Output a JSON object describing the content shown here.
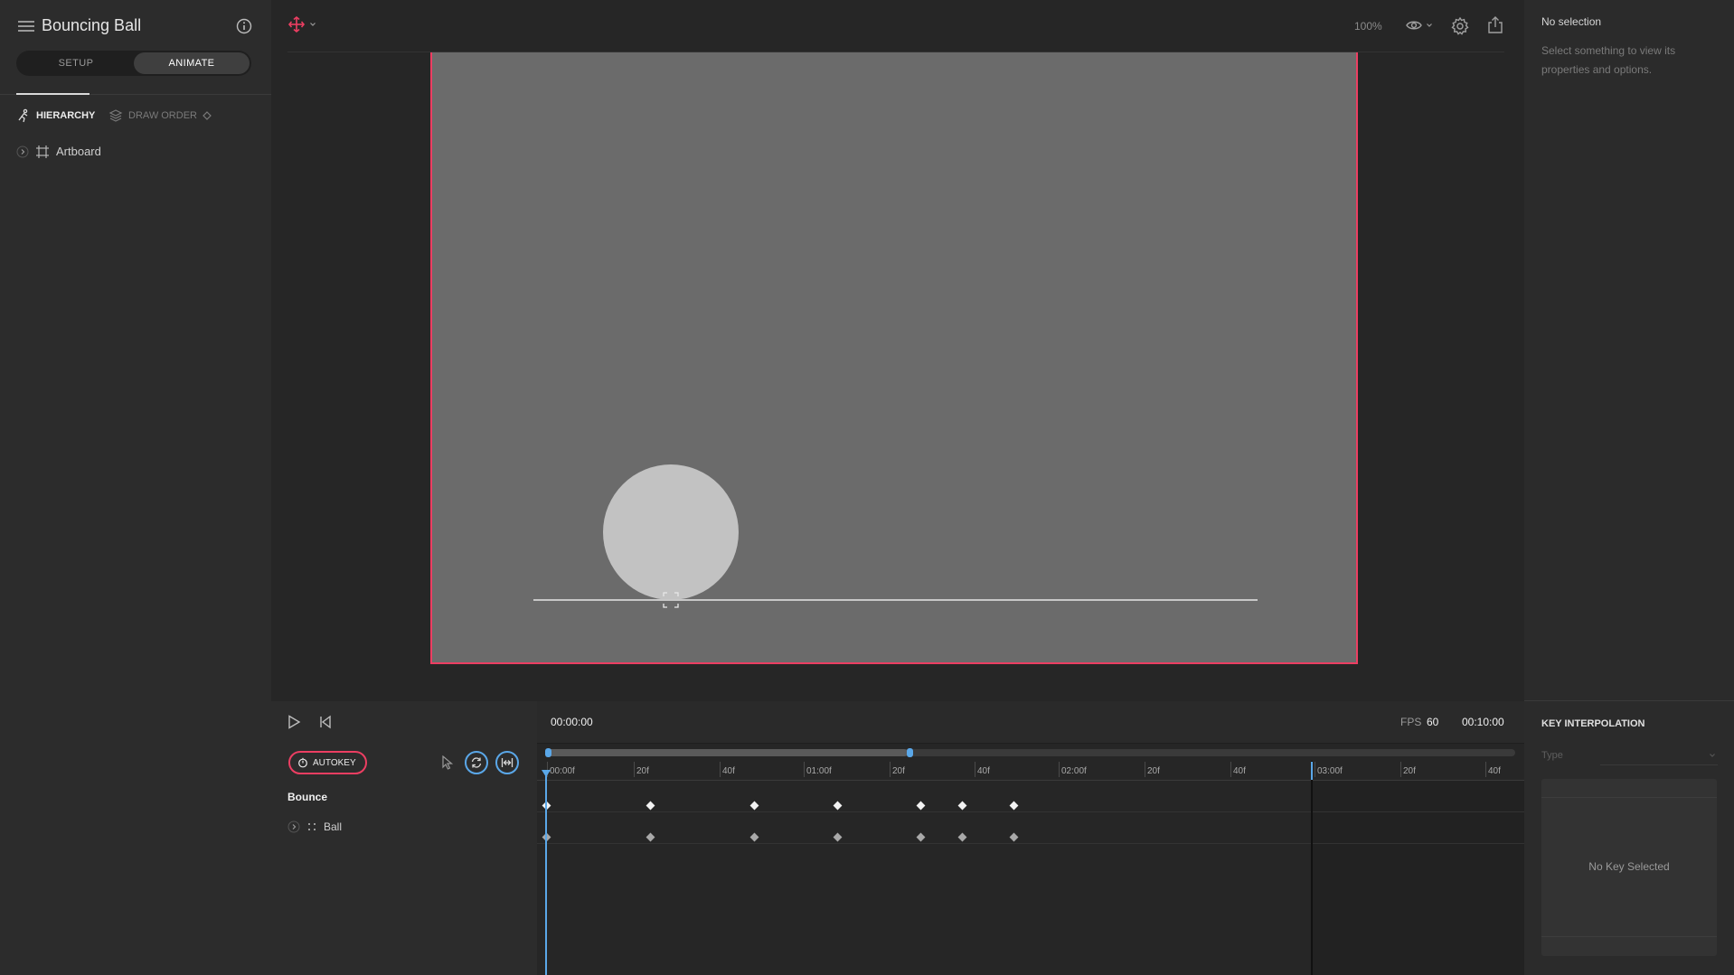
{
  "document": {
    "title": "Bouncing Ball"
  },
  "mode_toggle": {
    "setup": "SETUP",
    "animate": "ANIMATE",
    "active": "ANIMATE"
  },
  "left_tabs": {
    "hierarchy": "HIERARCHY",
    "draw_order": "DRAW ORDER",
    "active": "HIERARCHY"
  },
  "hierarchy": {
    "items": [
      {
        "label": "Artboard",
        "icon": "artboard-icon"
      }
    ]
  },
  "toolbar": {
    "tool_icon": "move-transform-icon",
    "zoom": "100%",
    "icons": [
      "eye-icon",
      "gear-icon",
      "export-icon"
    ]
  },
  "inspector": {
    "title": "No selection",
    "hint": "Select something to view its properties and options.",
    "key_interpolation": {
      "title": "KEY INTERPOLATION",
      "type_label": "Type",
      "empty": "No Key Selected"
    }
  },
  "timeline": {
    "current_time": "00:00:00",
    "fps_label": "FPS",
    "fps": "60",
    "duration": "00:10:00",
    "autokey": "AUTOKEY",
    "animation_name": "Bounce",
    "rows": [
      {
        "label": "Ball",
        "icon": "node-icon"
      }
    ],
    "ruler": [
      "00:00f",
      "20f",
      "40f",
      "01:00f",
      "20f",
      "40f",
      "02:00f",
      "20f",
      "40f",
      "03:00f",
      "20f",
      "40f"
    ],
    "keyframes": [
      0,
      20,
      40,
      56,
      72,
      80,
      90
    ]
  },
  "colors": {
    "accent_red": "#ec3e62",
    "accent_blue": "#5aa7e8",
    "artboard": "#6b6b6b",
    "ball": "#c2c2c2"
  }
}
